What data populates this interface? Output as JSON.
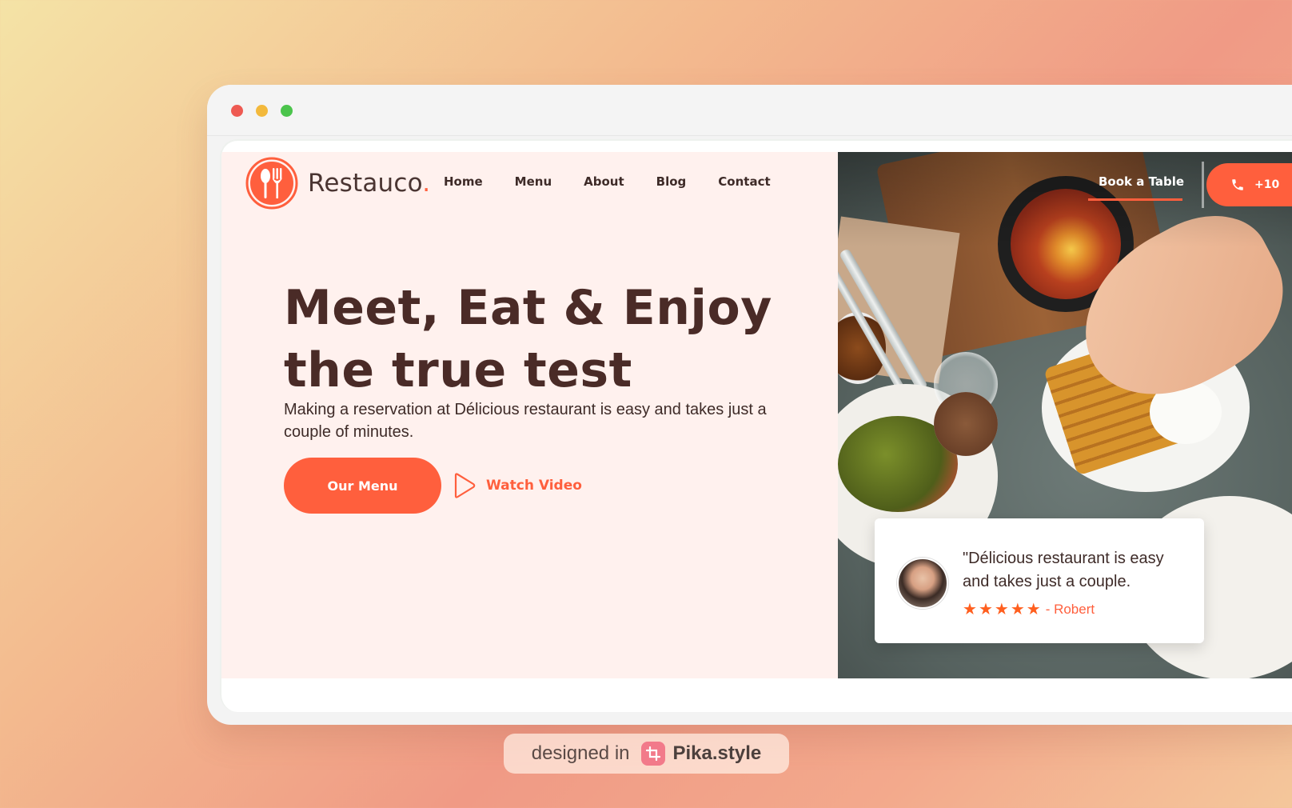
{
  "brand": {
    "name": "Restauco",
    "dot": "."
  },
  "nav": {
    "items": [
      "Home",
      "Menu",
      "About",
      "Blog",
      "Contact"
    ]
  },
  "header": {
    "book_label": "Book a Table",
    "phone_label": "+10"
  },
  "hero": {
    "headline_line1": "Meet, Eat & Enjoy",
    "headline_line2": "the true test",
    "subtext": "Making a reservation at Délicious restaurant is easy and takes just a couple of minutes.",
    "cta_label": "Our Menu",
    "video_label": "Watch Video"
  },
  "testimonial": {
    "quote": "\"Délicious restaurant is easy and takes just a couple.",
    "rating": 5,
    "author": "- Robert"
  },
  "badge": {
    "prefix": "designed in",
    "brand": "Pika.style"
  },
  "colors": {
    "accent": "#ff5f3d",
    "hero_bg": "#fff1ee",
    "heading": "#4a2b27"
  },
  "icons": [
    "restaurant-logo-icon",
    "play-icon",
    "phone-icon",
    "star-icon",
    "pika-crop-icon"
  ]
}
